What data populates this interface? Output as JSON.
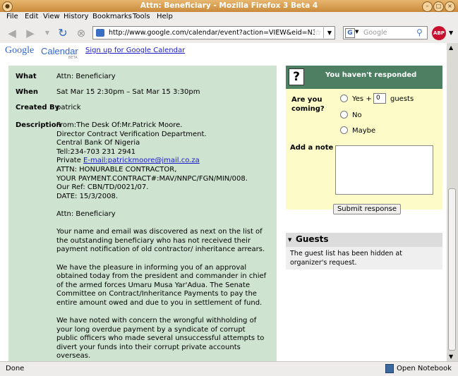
{
  "window": {
    "title": "Attn: Beneficiary - Mozilla Firefox 3 Beta 4"
  },
  "menu": [
    "File",
    "Edit",
    "View",
    "History",
    "Bookmarks",
    "Tools",
    "Help"
  ],
  "nav": {
    "url": "http://www.google.com/calendar/event?action=VIEW&eid=N3BhdmY",
    "search_placeholder": "Google",
    "adblock_label": "ABP"
  },
  "header": {
    "logo_google": "Google",
    "logo_calendar": "Calendar",
    "logo_beta": "BETA",
    "signup_link": "Sign up for Google Calendar"
  },
  "event": {
    "what_label": "What",
    "what_value": "Attn: Beneficiary",
    "when_label": "When",
    "when_value": "Sat Mar 15 2:30pm – Sat Mar 15 3:30pm",
    "created_label": "Created By",
    "created_value": "patrick",
    "description_label": "Description",
    "desc_part1": "From:The Desk Of:Mr.Patrick Moore.\nDirector Contract Verification Department.\nCentral Bank Of Nigeria\nTell:234-703 231 2941\nPrivate ",
    "desc_email": "E-mail:patrickmoore@jmail.co.za",
    "desc_part2": "\nATTN: HONURABLE CONTRACTOR,\nYOUR PAYMENT.CONTRACT#:MAV/NNPC/FGN/MIN/008.\nOur Ref: CBN/TD/0021/07.\nDATE: 15/3/2008.\n\nAttn: Beneficiary\n\nYour name and email was discovered as next on the list of the outstanding beneficiary who has not received their payment notification of old contractor/ inheritance arrears.\n\nWe have the pleasure in informing you of an approval obtained today from the president and commander in chief of the armed forces Umaru Musa Yar'Adua. The Senate Committee on Contract/Inheritance Payments to pay the entire amount owed and due to you in settlement of fund.\n\nWe have noted with concern the wrongful withholding of your long overdue payment by a syndicate of corrupt public officers who made several unsuccessful attempts to divert your funds into their corrupt private accounts overseas."
  },
  "response": {
    "header": "You haven't responded",
    "coming_label": "Are you coming?",
    "yes": "Yes +",
    "guests_count": "0",
    "guests_word": "guests",
    "no": "No",
    "maybe": "Maybe",
    "note_label": "Add a note",
    "submit": "Submit response"
  },
  "guests": {
    "title": "Guests",
    "text": "The guest list has been hidden at organizer's request."
  },
  "status": {
    "left": "Done",
    "right": "Open Notebook"
  }
}
